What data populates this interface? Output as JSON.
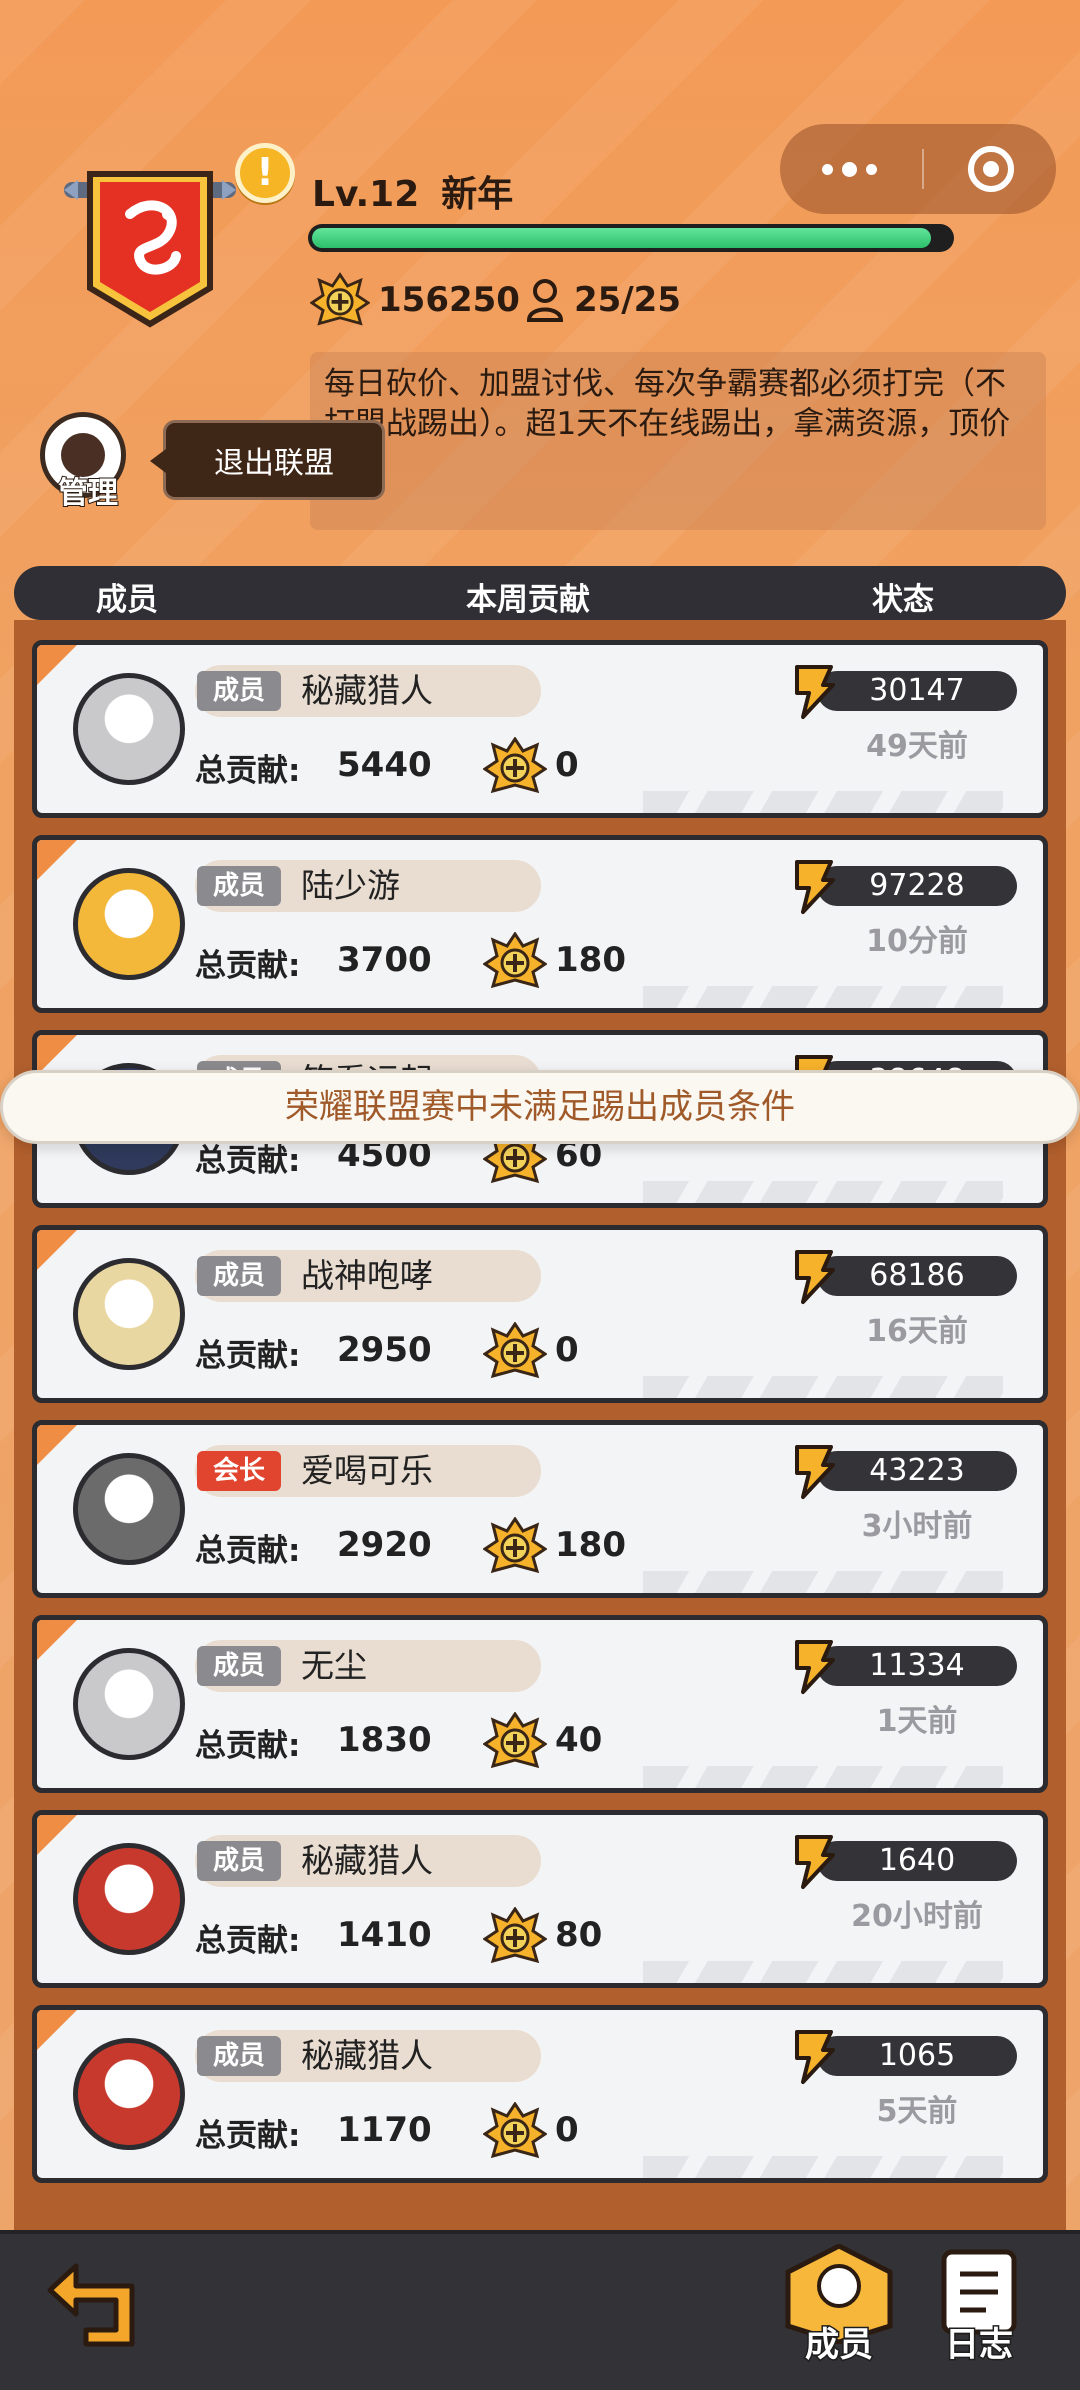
{
  "header": {
    "level": "Lv.12",
    "guild_name": "新年",
    "progress_fraction": 0.97,
    "medal_count": "156250",
    "member_count": "25/25",
    "notice": "每日砍价、加盟讨伐、每次争霸赛都必须打完（不打盟战踢出）。超1天不在线踢出，拿满资源，顶价踢"
  },
  "manage": {
    "label": "管理",
    "exit_tip": "退出联盟"
  },
  "table_header": {
    "col_member": "成员",
    "col_contrib": "本周贡献",
    "col_status": "状态"
  },
  "members": [
    {
      "role": "成员",
      "name": "秘藏猎人",
      "total_label": "总贡献:",
      "total": "5440",
      "weekly": "0",
      "power": "30147",
      "last_seen": "49天前"
    },
    {
      "role": "成员",
      "name": "陆少游",
      "total_label": "总贡献:",
      "total": "3700",
      "weekly": "180",
      "power": "97228",
      "last_seen": "10分前"
    },
    {
      "role": "成员",
      "name": "笑看运起",
      "total_label": "总贡献:",
      "total": "4500",
      "weekly": "60",
      "power": "38648",
      "last_seen": ""
    },
    {
      "role": "成员",
      "name": "战神咆哮",
      "total_label": "总贡献:",
      "total": "2950",
      "weekly": "0",
      "power": "68186",
      "last_seen": "16天前"
    },
    {
      "role": "会长",
      "name": "爱喝可乐",
      "total_label": "总贡献:",
      "total": "2920",
      "weekly": "180",
      "power": "43223",
      "last_seen": "3小时前"
    },
    {
      "role": "成员",
      "name": "无尘",
      "total_label": "总贡献:",
      "total": "1830",
      "weekly": "40",
      "power": "11334",
      "last_seen": "1天前"
    },
    {
      "role": "成员",
      "name": "秘藏猎人",
      "total_label": "总贡献:",
      "total": "1410",
      "weekly": "80",
      "power": "1640",
      "last_seen": "20小时前"
    },
    {
      "role": "成员",
      "name": "秘藏猎人",
      "total_label": "总贡献:",
      "total": "1170",
      "weekly": "0",
      "power": "1065",
      "last_seen": "5天前"
    }
  ],
  "toast": "荣耀联盟赛中未满足踢出成员条件",
  "bottom_nav": {
    "members": "成员",
    "log": "日志"
  },
  "icons": [
    "dragon-banner-icon",
    "alert-icon",
    "medal-icon",
    "user-icon",
    "power-icon",
    "back-arrow-icon",
    "members-icon",
    "log-icon",
    "more-icon",
    "target-icon"
  ],
  "colors": {
    "accent_orange": "#f39a57",
    "progress_green": "#2cc06b",
    "leader_red": "#e2452f"
  }
}
